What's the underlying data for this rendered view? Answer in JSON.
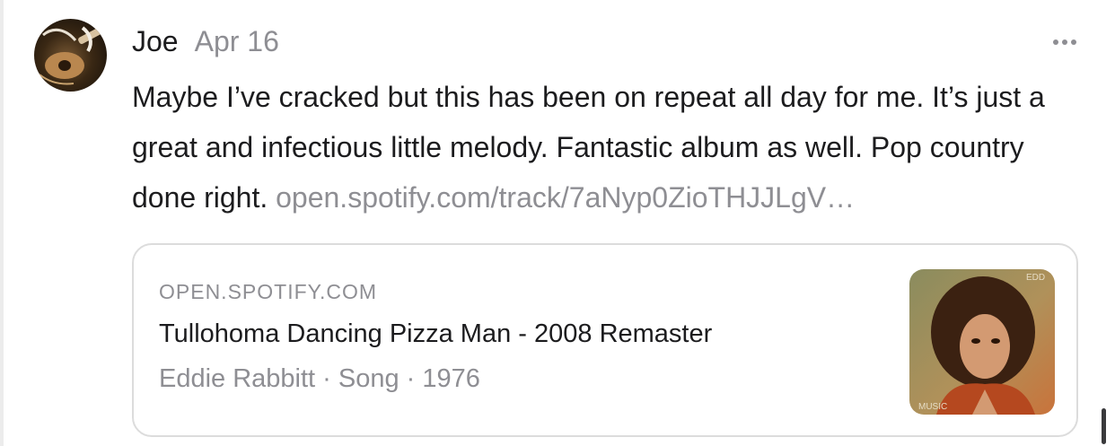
{
  "post": {
    "author": "Joe",
    "date": "Apr 16",
    "more_icon": "ellipsis-horizontal-icon",
    "body_text": "Maybe I’ve cracked but this has been on repeat all day for me. It’s just a great and infectious little melody. Fantastic album as well. Pop country done right. ",
    "link_text": "open.spotify.com/track/7aNyp0ZioTHJJLgV…",
    "avatar_icon": "guitar-avatar-icon"
  },
  "link_card": {
    "domain": "OPEN.SPOTIFY.COM",
    "title": "Tullohoma Dancing Pizza Man - 2008 Remaster",
    "subtitle": "Eddie Rabbitt · Song · 1976",
    "thumbnail_icon": "album-cover-image"
  },
  "colors": {
    "text_primary": "#1c1c1e",
    "text_secondary": "#8e8e93",
    "card_border": "#dcdcdc"
  }
}
